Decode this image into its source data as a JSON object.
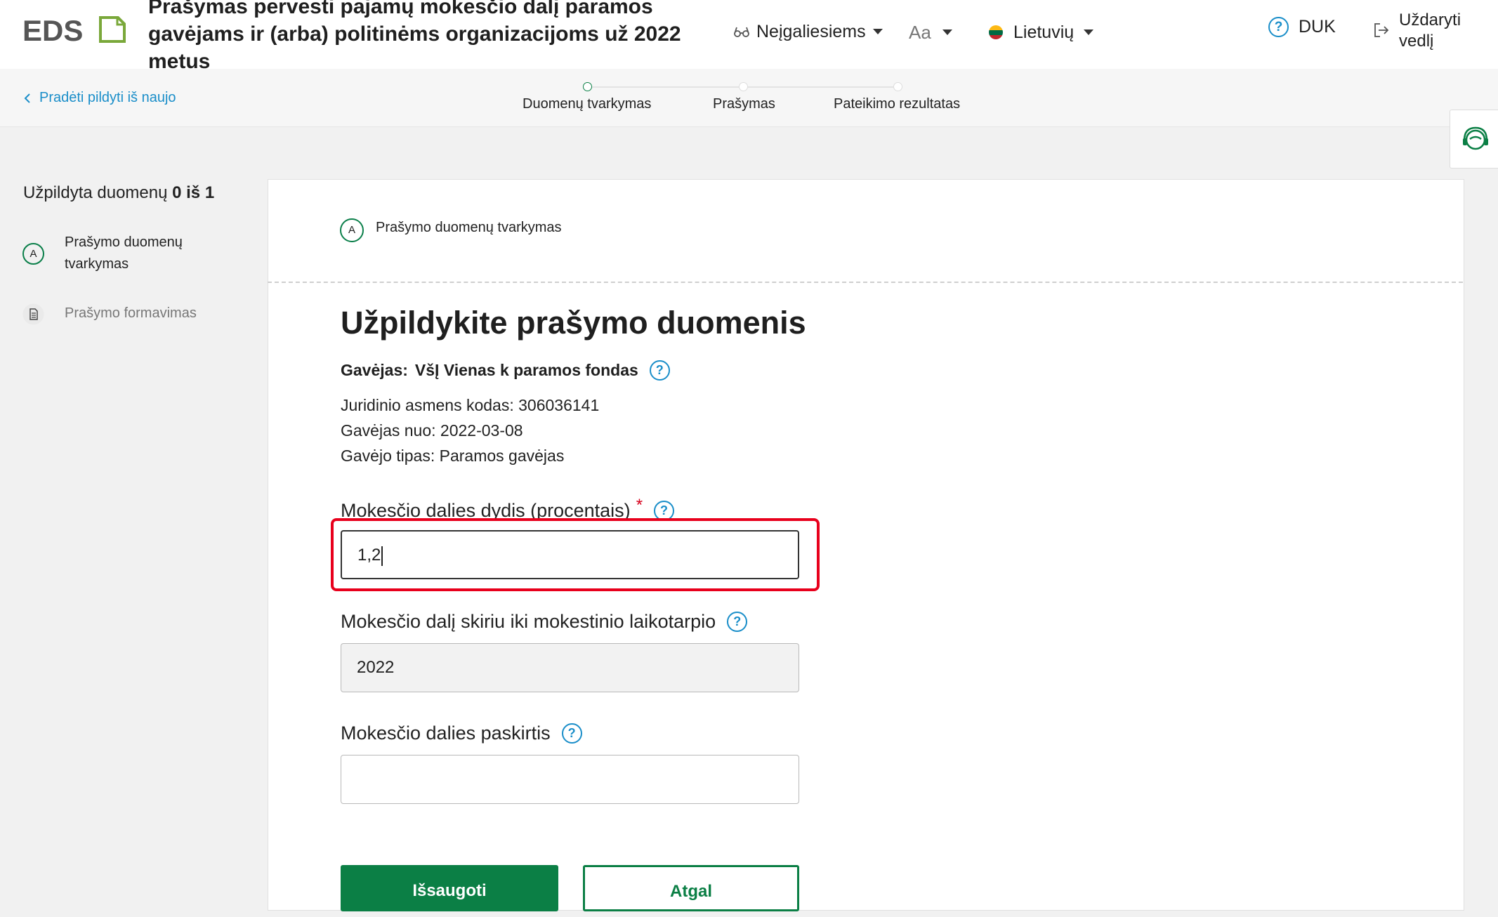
{
  "header": {
    "logo_text": "EDS",
    "document_title": "Prašymas pervesti pajamų mokesčio dalį paramos gavėjams ir (arba) politinėms organizacijoms už 2022 metus",
    "accessibility_label": "Neįgaliesiems",
    "font_size_label": "Aa",
    "language_label": "Lietuvių",
    "faq_label": "DUK",
    "close_label": "Uždaryti vedlį",
    "colors": {
      "brand_green": "#0b7f45",
      "link_blue": "#1a8ec9",
      "error_red": "#e8001c"
    }
  },
  "subbar": {
    "restart_label": "Pradėti pildyti iš naujo",
    "steps": [
      {
        "label": "Duomenų tvarkymas",
        "active": true
      },
      {
        "label": "Prašymas",
        "active": false
      },
      {
        "label": "Pateikimo rezultatas",
        "active": false
      }
    ]
  },
  "sidebar": {
    "progress_prefix": "Užpildyta duomenų",
    "progress_value": "0 iš 1",
    "items": [
      {
        "badge": "A",
        "label_line1": "Prašymo duomenų",
        "label_line2": "tvarkymas",
        "icon": "letter-badge"
      },
      {
        "label": "Prašymo formavimas",
        "icon": "document-icon"
      }
    ]
  },
  "form": {
    "section_badge": "A",
    "section_title": "Prašymo duomenų tvarkymas",
    "title": "Užpildykite prašymo duomenis",
    "recipient_prefix": "Gavėjas:",
    "recipient_name": "VšĮ Vienas k paramos fondas",
    "legal_code_line": "Juridinio asmens kodas: 306036141",
    "recipient_since_line": "Gavėjas nuo: 2022-03-08",
    "recipient_type_line": "Gavėjo tipas: Paramos gavėjas",
    "percent_label": "Mokesčio dalies dydis (procentais)",
    "percent_required_mark": "*",
    "percent_value": "1,2",
    "period_label": "Mokesčio dalį skiriu iki mokestinio laikotarpio",
    "period_value": "2022",
    "purpose_label": "Mokesčio dalies paskirtis",
    "purpose_value": "",
    "help_symbol": "?",
    "save_label": "Išsaugoti",
    "back_label": "Atgal"
  }
}
